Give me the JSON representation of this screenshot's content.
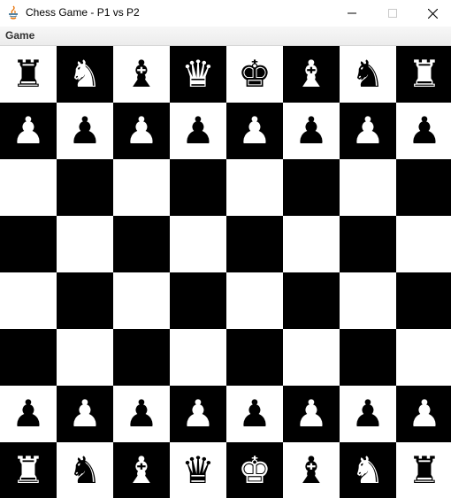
{
  "window": {
    "title": "Chess Game - P1 vs P2",
    "controls": {
      "minimize": "minimize",
      "maximize": "maximize",
      "close": "close"
    }
  },
  "menubar": {
    "items": [
      {
        "label": "Game"
      }
    ]
  },
  "board": {
    "light_color": "#ffffff",
    "dark_color": "#000000",
    "rows": [
      [
        {
          "piece": "rook",
          "glyph": "♜"
        },
        {
          "piece": "knight",
          "glyph": "♞"
        },
        {
          "piece": "bishop",
          "glyph": "♝"
        },
        {
          "piece": "queen",
          "glyph": "♛"
        },
        {
          "piece": "king",
          "glyph": "♚"
        },
        {
          "piece": "bishop",
          "glyph": "♝"
        },
        {
          "piece": "knight",
          "glyph": "♞"
        },
        {
          "piece": "rook",
          "glyph": "♜"
        }
      ],
      [
        {
          "piece": "pawn",
          "glyph": "♟"
        },
        {
          "piece": "pawn",
          "glyph": "♟"
        },
        {
          "piece": "pawn",
          "glyph": "♟"
        },
        {
          "piece": "pawn",
          "glyph": "♟"
        },
        {
          "piece": "pawn",
          "glyph": "♟"
        },
        {
          "piece": "pawn",
          "glyph": "♟"
        },
        {
          "piece": "pawn",
          "glyph": "♟"
        },
        {
          "piece": "pawn",
          "glyph": "♟"
        }
      ],
      [
        null,
        null,
        null,
        null,
        null,
        null,
        null,
        null
      ],
      [
        null,
        null,
        null,
        null,
        null,
        null,
        null,
        null
      ],
      [
        null,
        null,
        null,
        null,
        null,
        null,
        null,
        null
      ],
      [
        null,
        null,
        null,
        null,
        null,
        null,
        null,
        null
      ],
      [
        {
          "piece": "pawn",
          "glyph": "♟"
        },
        {
          "piece": "pawn",
          "glyph": "♟"
        },
        {
          "piece": "pawn",
          "glyph": "♟"
        },
        {
          "piece": "pawn",
          "glyph": "♟"
        },
        {
          "piece": "pawn",
          "glyph": "♟"
        },
        {
          "piece": "pawn",
          "glyph": "♟"
        },
        {
          "piece": "pawn",
          "glyph": "♟"
        },
        {
          "piece": "pawn",
          "glyph": "♟"
        }
      ],
      [
        {
          "piece": "rook",
          "glyph": "♜"
        },
        {
          "piece": "knight",
          "glyph": "♞"
        },
        {
          "piece": "bishop",
          "glyph": "♝"
        },
        {
          "piece": "queen",
          "glyph": "♛"
        },
        {
          "piece": "king",
          "glyph": "♚"
        },
        {
          "piece": "bishop",
          "glyph": "♝"
        },
        {
          "piece": "knight",
          "glyph": "♞"
        },
        {
          "piece": "rook",
          "glyph": "♜"
        }
      ]
    ]
  }
}
